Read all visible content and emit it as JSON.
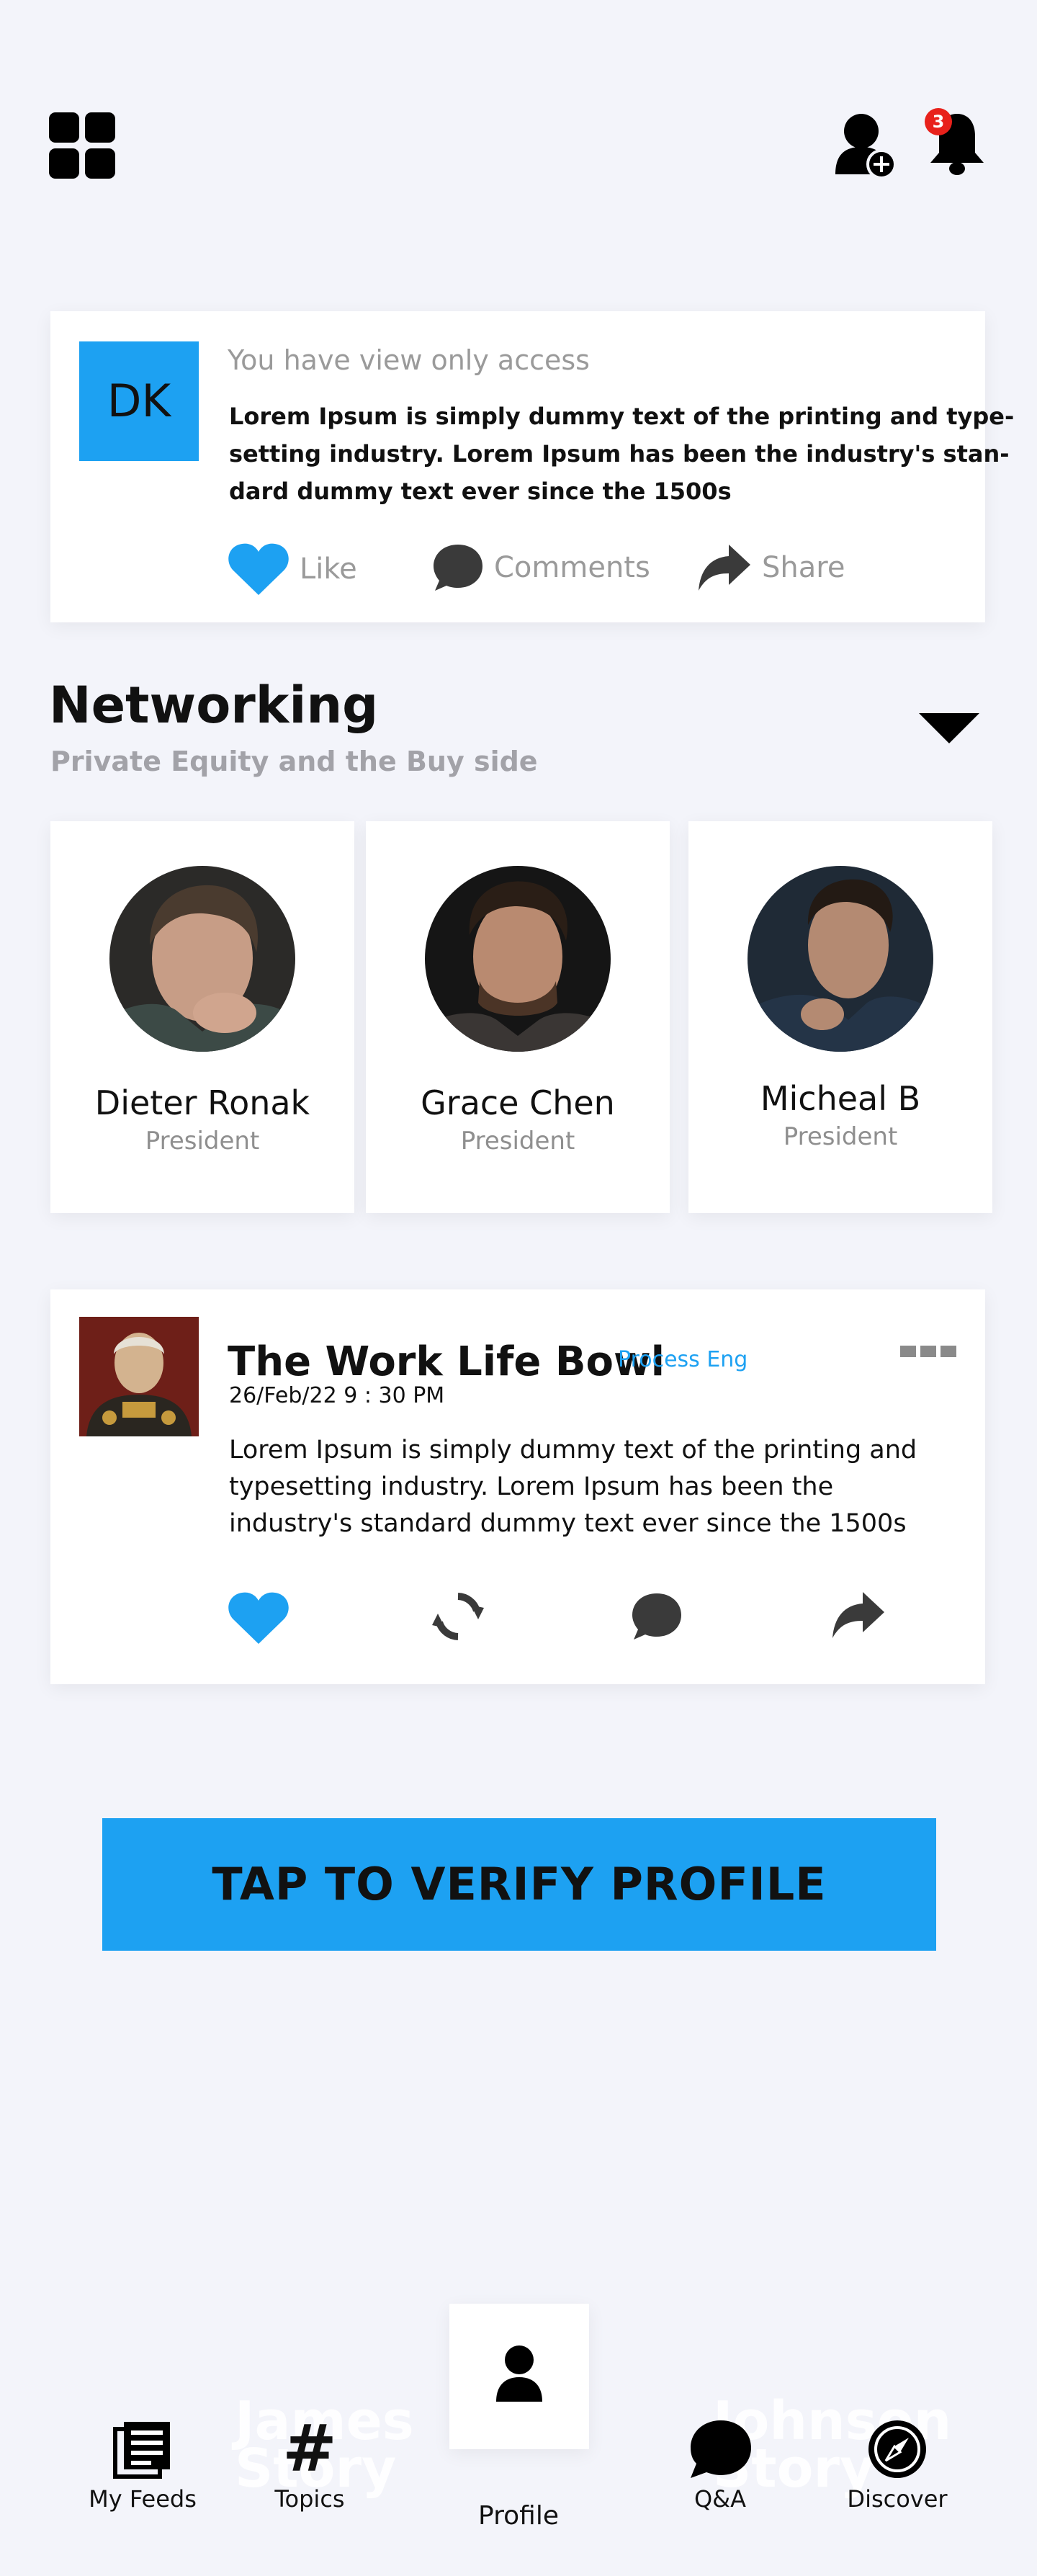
{
  "header": {
    "menu_icon": "grid-menu-icon",
    "add_user_icon": "add-user-icon",
    "notification_icon": "bell-icon",
    "notification_count": "3"
  },
  "post1": {
    "avatar_initials": "DK",
    "access_note": "You have view only access",
    "body_lines": [
      "Lorem Ipsum is simply dummy text of the printing and type-",
      "setting industry. Lorem Ipsum has been the industry's stan-",
      "dard dummy text ever since the 1500s"
    ],
    "actions": {
      "like": "Like",
      "comments": "Comments",
      "share": "Share"
    },
    "like_color": "#1da1f2"
  },
  "networking": {
    "title": "Networking",
    "subtitle": "Private Equity and the Buy side",
    "people": [
      {
        "name": "Dieter Ronak",
        "role": "President"
      },
      {
        "name": "Grace Chen",
        "role": "President"
      },
      {
        "name": "Micheal B",
        "role": "President"
      }
    ]
  },
  "post2": {
    "title": "The Work Life Bowl",
    "tag": "Process Eng",
    "date": "26/Feb/22  9 : 30 PM",
    "body": "Lorem Ipsum is simply dummy text of the printing and typesetting industry. Lorem Ipsum has been the industry's standard dummy text ever since the 1500s"
  },
  "cta": {
    "label": "TAP TO VERIFY PROFILE"
  },
  "bottom_nav": {
    "items": [
      {
        "label": "My Feeds",
        "icon": "feed-icon"
      },
      {
        "label": "Topics",
        "icon": "hashtag-icon"
      },
      {
        "label": "Profile",
        "icon": "profile-icon"
      },
      {
        "label": "Q&A",
        "icon": "chat-icon"
      },
      {
        "label": "Discover",
        "icon": "compass-icon"
      }
    ],
    "ghost_left": [
      "James",
      "Story"
    ],
    "ghost_right": [
      "Johnson",
      "Story"
    ]
  },
  "colors": {
    "accent": "#1da1f2",
    "badge": "#e8211b",
    "background": "#f3f4fa"
  }
}
